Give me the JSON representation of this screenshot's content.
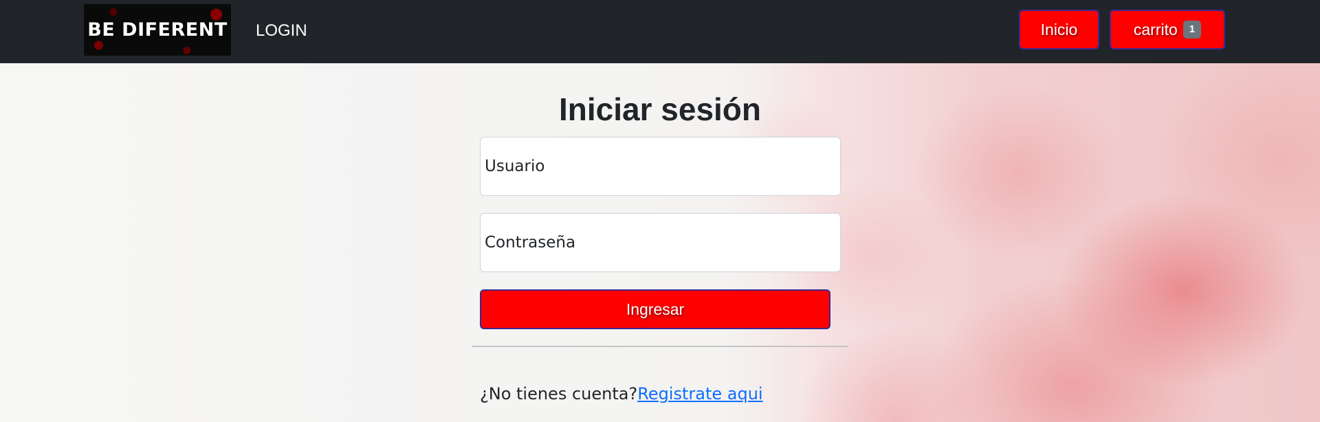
{
  "navbar": {
    "brand": "BE DIFERENT",
    "login_link": "LOGIN",
    "inicio_button": "Inicio",
    "cart_button": "carrito",
    "cart_count": "1"
  },
  "login": {
    "title": "Iniciar sesión",
    "username_placeholder": "Usuario",
    "password_placeholder": "Contraseña",
    "submit_label": "Ingresar",
    "no_account_text": "¿No tienes cuenta?",
    "register_link": "Registrate aqui"
  },
  "colors": {
    "navbar_bg": "#212529",
    "accent_red": "#ff0000",
    "badge_gray": "#6c757d",
    "link_blue": "#0d6efd"
  }
}
